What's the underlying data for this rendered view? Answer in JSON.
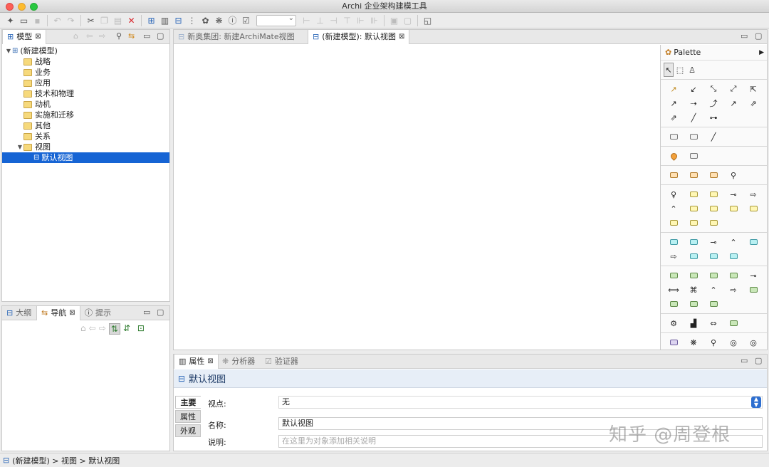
{
  "window": {
    "title": "Archi 企业架构建模工具"
  },
  "model_panel": {
    "tab_label": "模型",
    "tree": {
      "root": "(新建模型)",
      "folders": [
        "战略",
        "业务",
        "应用",
        "技术和物理",
        "动机",
        "实施和迁移",
        "其他",
        "关系",
        "视图"
      ],
      "view_item": "默认视图"
    }
  },
  "nav_panel": {
    "tabs": [
      "大纲",
      "导航",
      "提示"
    ]
  },
  "editor": {
    "tabs": [
      "新奥集团: 新建ArchiMate视图",
      "(新建模型): 默认视图"
    ]
  },
  "palette": {
    "title": "Palette"
  },
  "properties": {
    "tabs": [
      "属性",
      "分析器",
      "验证器"
    ],
    "title": "默认视图",
    "side_tabs": [
      "主要",
      "属性",
      "外观"
    ],
    "fields": {
      "viewpoint_label": "视点:",
      "viewpoint_value": "无",
      "name_label": "名称:",
      "name_value": "默认视图",
      "desc_label": "说明:",
      "desc_placeholder": "在这里为对象添加相关说明"
    }
  },
  "statusbar": {
    "path": "(新建模型) > 视图 > 默认视图"
  },
  "watermark": {
    "text": "知乎 @周登根"
  }
}
